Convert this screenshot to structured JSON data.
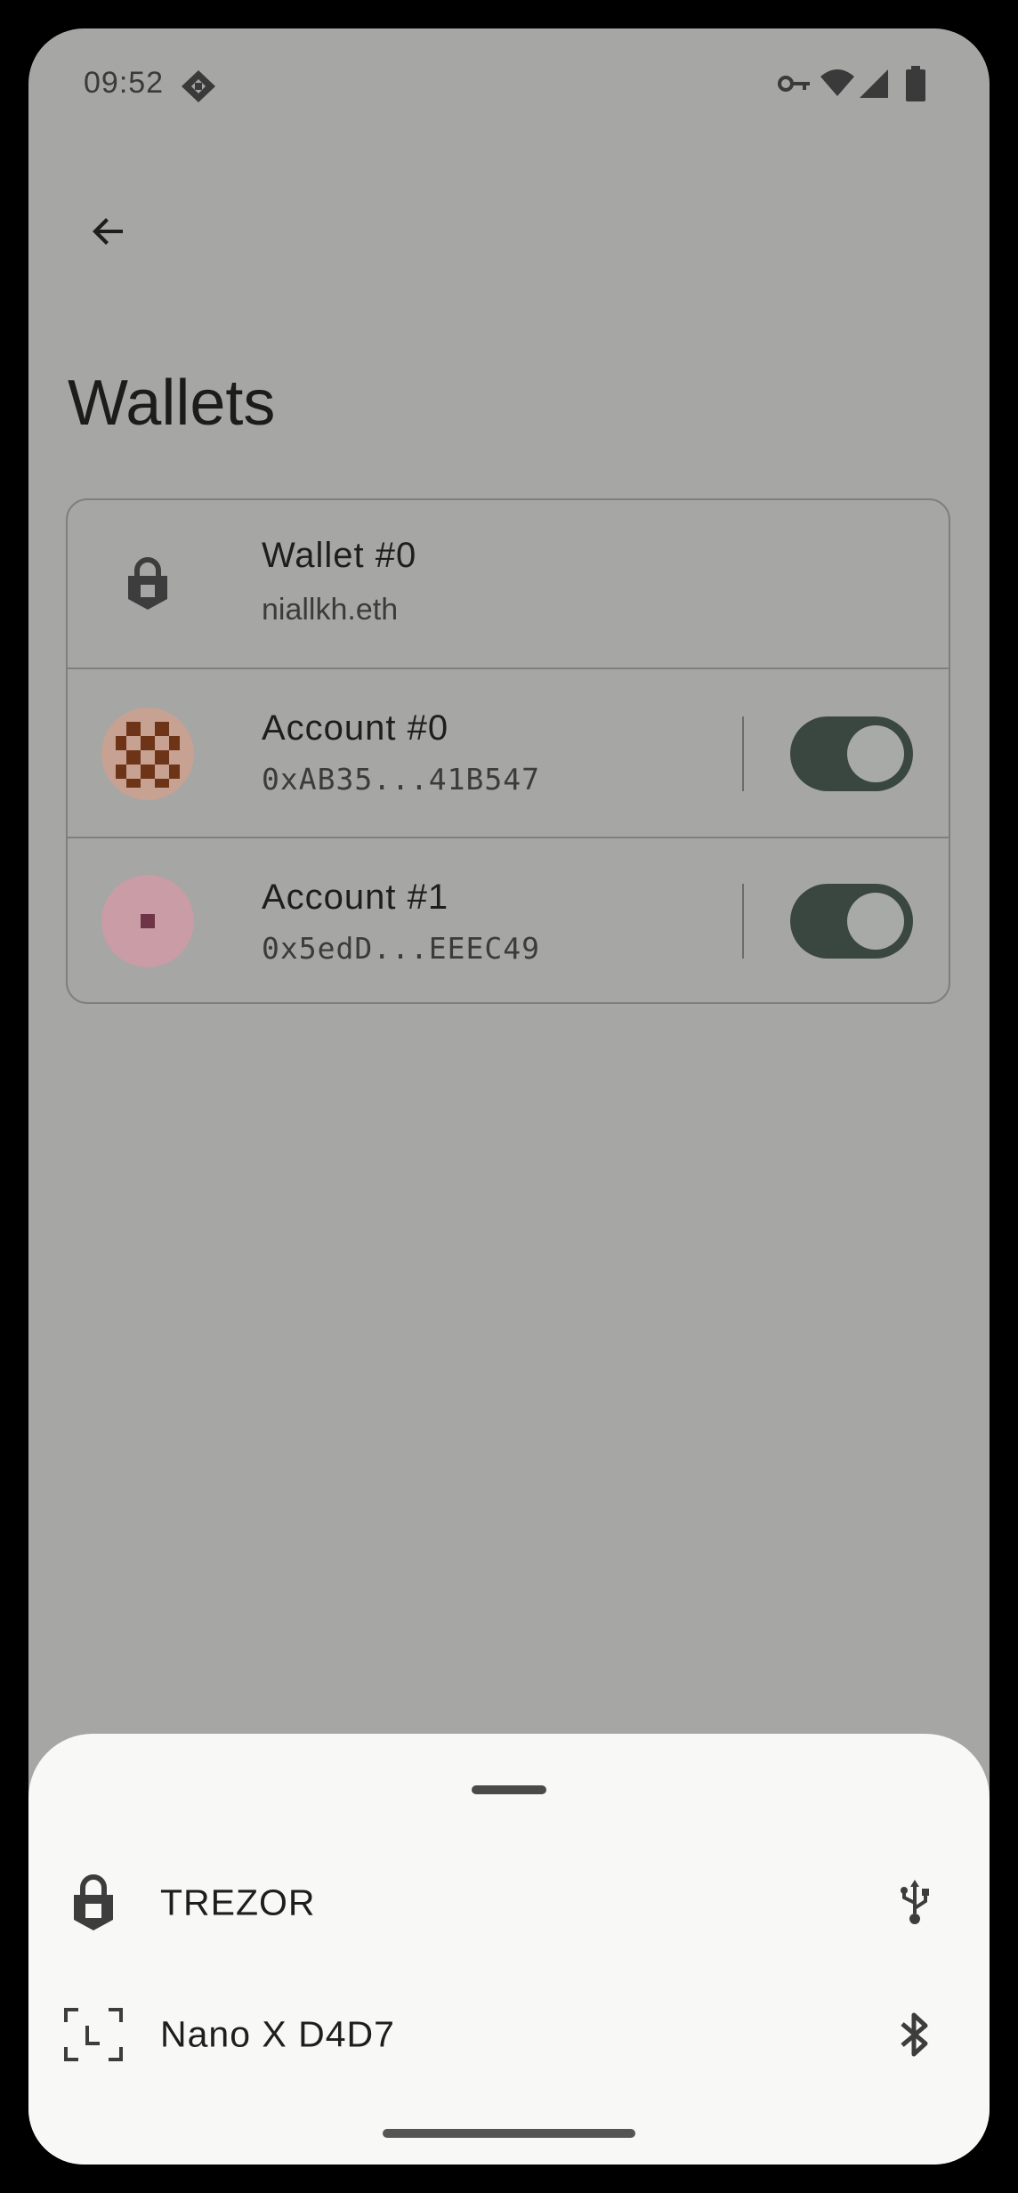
{
  "status_bar": {
    "time": "09:52",
    "icons": [
      "app-notification-icon",
      "vpn-key-icon",
      "wifi-icon",
      "cell-signal-icon",
      "battery-icon"
    ]
  },
  "app_bar": {
    "back_icon": "arrow-back-icon"
  },
  "page_title": "Wallets",
  "wallet_card": {
    "wallet": {
      "icon": "lock-icon",
      "title": "Wallet #0",
      "subtitle": "niallkh.eth"
    },
    "accounts": [
      {
        "title": "Account #0",
        "address": "0xAB35...41B547",
        "enabled": true,
        "avatar_color": "#c7a191",
        "avatar_pattern_color": "#6e3418"
      },
      {
        "title": "Account #1",
        "address": "0x5edD...EEEC49",
        "enabled": true,
        "avatar_color": "#c99ca6",
        "avatar_pattern_color": "#6e3547"
      }
    ]
  },
  "bottom_sheet": {
    "items": [
      {
        "label": "TREZOR",
        "lead_icon": "lock-icon",
        "trail_icon": "usb-icon"
      },
      {
        "label": "Nano X D4D7",
        "lead_icon": "ledger-icon",
        "trail_icon": "bluetooth-icon"
      }
    ]
  },
  "colors": {
    "scrim_background": "#a6a6a5",
    "sheet_background": "#f8f8f6",
    "toggle_track": "#3a4741"
  }
}
